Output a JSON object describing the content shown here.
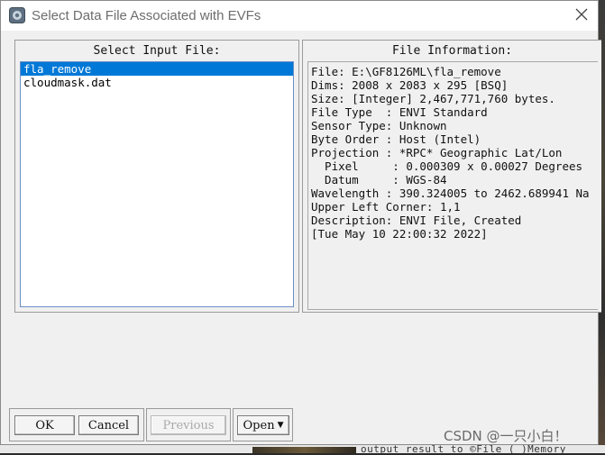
{
  "window": {
    "title": "Select Data File Associated with EVFs"
  },
  "left_panel": {
    "title": "Select Input File:",
    "files": [
      {
        "name": "fla_remove",
        "selected": true
      },
      {
        "name": "cloudmask.dat",
        "selected": false
      }
    ]
  },
  "right_panel": {
    "title": "File Information:",
    "lines": [
      "File: E:\\GF8126ML\\fla_remove",
      "Dims: 2008 x 2083 x 295 [BSQ]",
      "Size: [Integer] 2,467,771,760 bytes.",
      "File Type  : ENVI Standard",
      "Sensor Type: Unknown",
      "Byte Order : Host (Intel)",
      "Projection : *RPC* Geographic Lat/Lon",
      "  Pixel     : 0.000309 x 0.00027 Degrees",
      "  Datum     : WGS-84",
      "Wavelength : 390.324005 to 2462.689941 Na",
      "Upper Left Corner: 1,1",
      "Description: ENVI File, Created",
      "[Tue May 10 22:00:32 2022]"
    ]
  },
  "buttons": {
    "ok": "OK",
    "cancel": "Cancel",
    "previous": "Previous",
    "open": "Open",
    "open_arrow": "▼"
  },
  "background": {
    "bottom_text": "output result to ©File  ( )Memory"
  },
  "watermark": "CSDN @一只小白！",
  "icons": {
    "app": "envi-app-icon",
    "close": "close-icon"
  },
  "colors": {
    "selection": "#0078d7",
    "list_border": "#6c8fc7"
  }
}
